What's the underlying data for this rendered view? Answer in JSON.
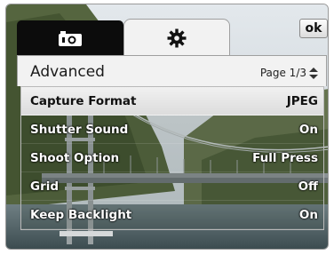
{
  "header": {
    "camera_tab_icon": "camera-icon",
    "settings_tab_icon": "gear-icon",
    "ok_label": "ok"
  },
  "panel": {
    "title": "Advanced",
    "page_label": "Page 1/3",
    "page_icon": "up-down-arrows-icon"
  },
  "menu": {
    "items": [
      {
        "label": "Capture Format",
        "value": "JPEG",
        "selected": true
      },
      {
        "label": "Shutter Sound",
        "value": "On",
        "selected": false
      },
      {
        "label": "Shoot Option",
        "value": "Full Press",
        "selected": false
      },
      {
        "label": "Grid",
        "value": "Off",
        "selected": false
      },
      {
        "label": "Keep Backlight",
        "value": "On",
        "selected": false
      }
    ]
  },
  "colors": {
    "selected_row": "#e6e6e6",
    "panel_bg": "#f2f2f2",
    "tab_dark": "#0c0c0c"
  }
}
